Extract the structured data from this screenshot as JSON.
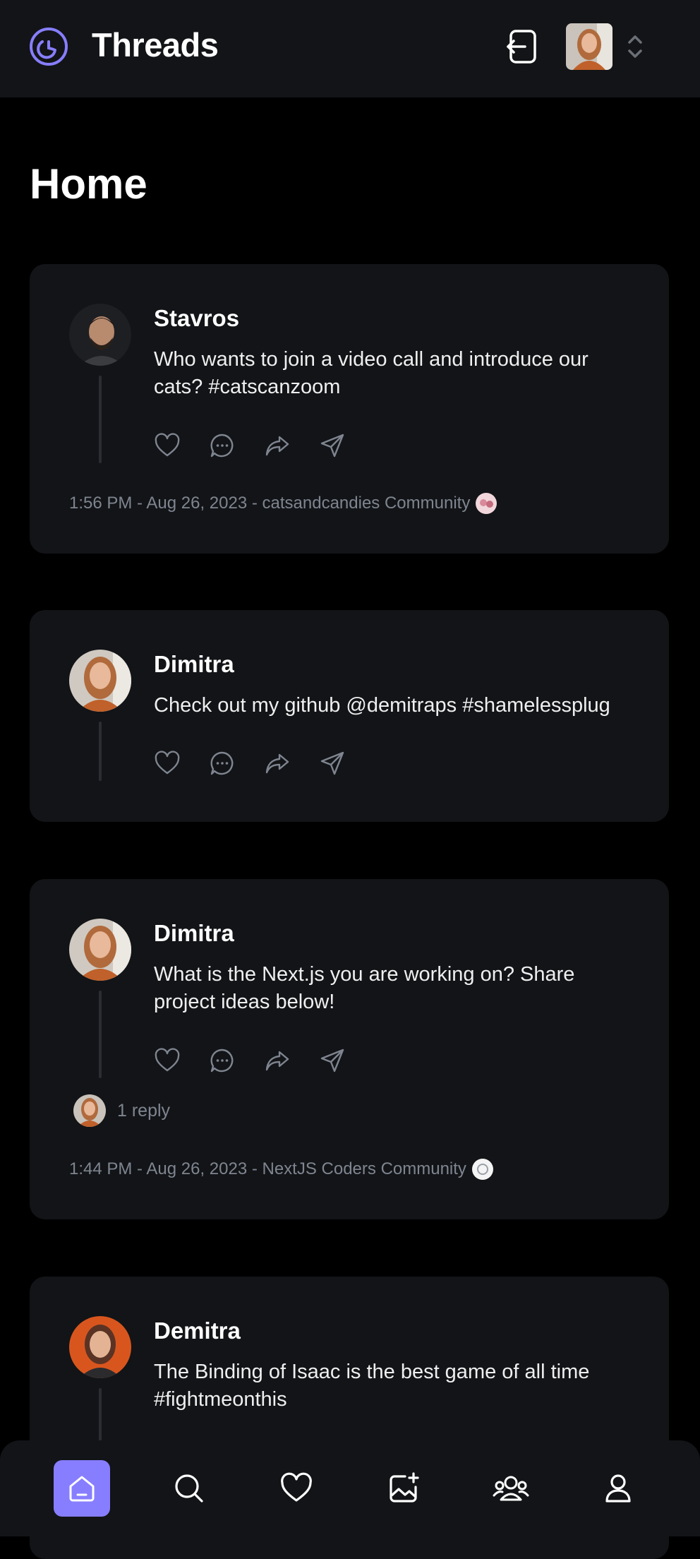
{
  "app": {
    "title": "Threads"
  },
  "page": {
    "title": "Home"
  },
  "colors": {
    "accent": "#877eff",
    "card_bg": "#121417",
    "muted": "#7f8590"
  },
  "threads": [
    {
      "author": "Stavros",
      "content": "Who wants to join a video call and introduce our cats? #catscanzoom",
      "meta": "1:56 PM - Aug 26, 2023 - catsandcandies Community"
    },
    {
      "author": "Dimitra",
      "content": "Check out my github @demitraps #shamelessplug"
    },
    {
      "author": "Dimitra",
      "content": "What is the Next.js you are working on? Share project ideas below!",
      "replies": "1 reply",
      "meta": "1:44 PM - Aug 26, 2023 - NextJS Coders Community"
    },
    {
      "author": "Demitra",
      "content": "The Binding of Isaac is the best game of all time #fightmeonthis"
    }
  ],
  "icons": {
    "actions": [
      "heart-icon",
      "comment-icon",
      "repost-icon",
      "share-icon"
    ],
    "bottom_nav": [
      "home-icon",
      "search-icon",
      "heart-icon",
      "create-thread-icon",
      "communities-icon",
      "profile-icon"
    ]
  }
}
